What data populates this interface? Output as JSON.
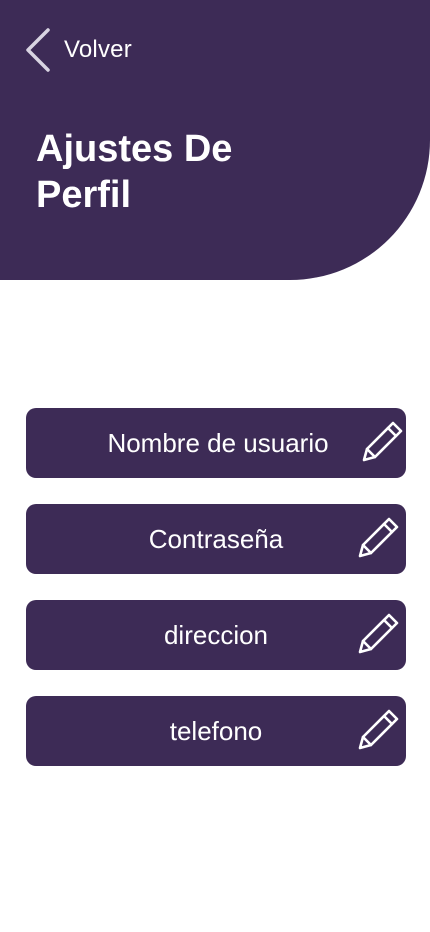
{
  "header": {
    "back_label": "Volver",
    "title": "Ajustes De Perfil"
  },
  "fields": [
    {
      "label": "Nombre de usuario",
      "icon": "pencil-icon"
    },
    {
      "label": "Contraseña",
      "icon": "pencil-icon"
    },
    {
      "label": "direccion",
      "icon": "pencil-icon"
    },
    {
      "label": "telefono",
      "icon": "pencil-icon"
    }
  ],
  "colors": {
    "primary": "#3d2b56",
    "background": "#ffffff",
    "text_on_primary": "#ffffff"
  }
}
